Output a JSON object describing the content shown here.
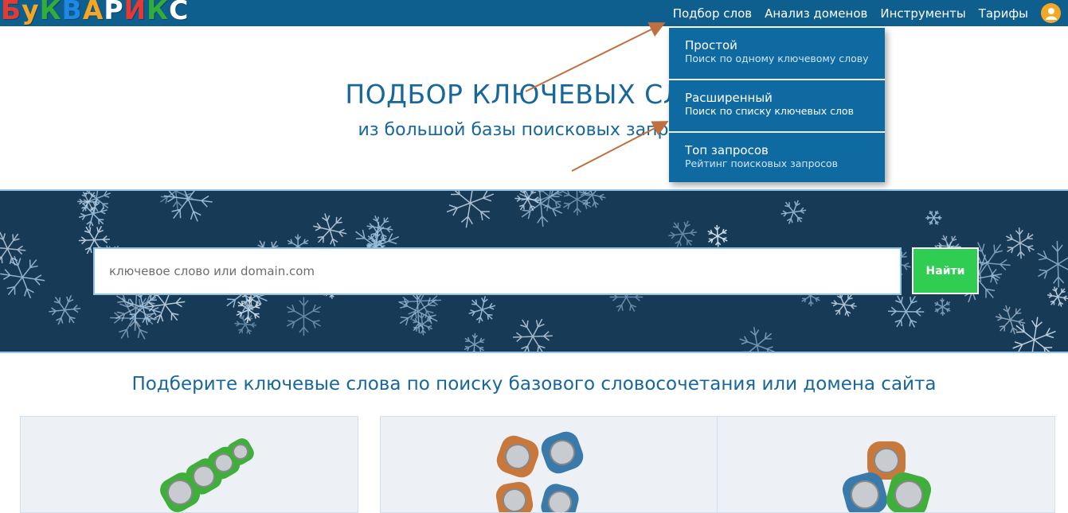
{
  "brand": {
    "logo_letters": [
      {
        "char": "Б",
        "color": "#e53935"
      },
      {
        "char": "у",
        "color": "#f5a623"
      },
      {
        "char": "К",
        "color": "#2fae3a"
      },
      {
        "char": "В",
        "color": "#1e88e5"
      },
      {
        "char": "А",
        "color": "#f5a623"
      },
      {
        "char": "Р",
        "color": "#ffffff"
      },
      {
        "char": "И",
        "color": "#e53935"
      },
      {
        "char": "К",
        "color": "#2fae3a"
      },
      {
        "char": "С",
        "color": "#ffffff"
      }
    ]
  },
  "nav": {
    "items": [
      {
        "label": "Подбор слов"
      },
      {
        "label": "Анализ доменов"
      },
      {
        "label": "Инструменты"
      },
      {
        "label": "Тарифы"
      }
    ],
    "user_icon": "user-icon"
  },
  "dropdown": {
    "items": [
      {
        "title": "Простой",
        "subtitle": "Поиск по одному ключевому слову"
      },
      {
        "title": "Расширенный",
        "subtitle": "Поиск по списку ключевых слов"
      },
      {
        "title": "Топ запросов",
        "subtitle": "Рейтинг поисковых запросов"
      }
    ]
  },
  "hero": {
    "title": "ПОДБОР КЛЮЧЕВЫХ СЛОВ",
    "subtitle": "из большой базы поисковых запросов"
  },
  "search": {
    "placeholder": "ключевое слово или domain.com",
    "button_label": "Найти"
  },
  "section": {
    "heading": "Подберите ключевые слова по поиску базового словосочетания или домена сайта"
  },
  "colors": {
    "nav_bg": "#0e5e8e",
    "dropdown_bg": "#0e6aa0",
    "accent_green": "#2fce52",
    "frost_bg": "#173a57",
    "annotation_arrow": "#c07040"
  }
}
